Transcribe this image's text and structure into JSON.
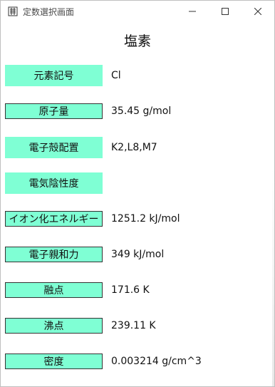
{
  "window": {
    "title": "定数選択画面",
    "controls": {
      "minimize": "minimize-icon",
      "maximize": "maximize-icon",
      "close": "close-icon"
    }
  },
  "element": {
    "name": "塩素"
  },
  "properties": [
    {
      "label": "元素記号",
      "value": "Cl"
    },
    {
      "label": "原子量",
      "value": "35.45 g/mol"
    },
    {
      "label": "電子殻配置",
      "value": "K2,L8,M7"
    },
    {
      "label": "電気陰性度",
      "value": ""
    },
    {
      "label": "イオン化エネルギー",
      "value": "1251.2 kJ/mol"
    },
    {
      "label": "電子親和力",
      "value": "349 kJ/mol"
    },
    {
      "label": "融点",
      "value": "171.6 K"
    },
    {
      "label": "沸点",
      "value": "239.11 K"
    },
    {
      "label": "密度",
      "value": "0.003214 g/cm^3"
    }
  ],
  "colors": {
    "label_bg": "#7fffd4",
    "label_border": "#333333"
  }
}
